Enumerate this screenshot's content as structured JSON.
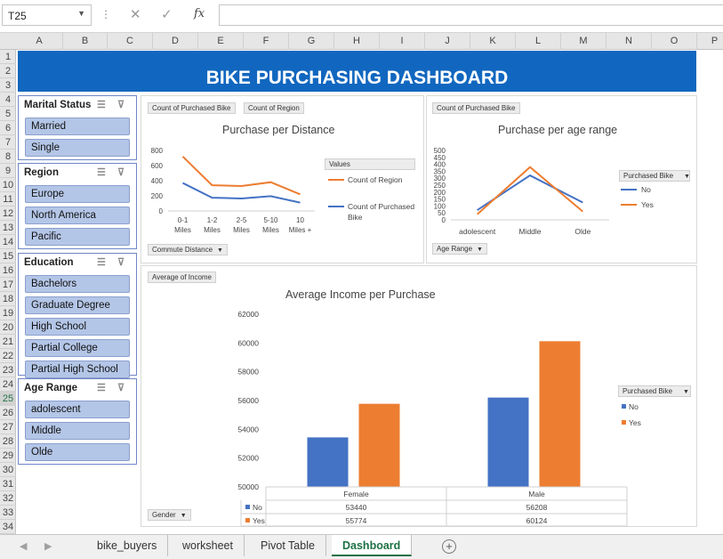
{
  "formula_bar": {
    "name_box": "T25",
    "formula": ""
  },
  "columns": [
    "A",
    "B",
    "C",
    "D",
    "E",
    "F",
    "G",
    "H",
    "I",
    "J",
    "K",
    "L",
    "M",
    "N",
    "O",
    "P"
  ],
  "rows": [
    "1",
    "2",
    "3",
    "4",
    "5",
    "6",
    "7",
    "8",
    "9",
    "10",
    "11",
    "12",
    "13",
    "14",
    "15",
    "16",
    "17",
    "18",
    "19",
    "20",
    "21",
    "22",
    "23",
    "24",
    "25",
    "26",
    "27",
    "28",
    "29",
    "30",
    "31",
    "32",
    "33",
    "34"
  ],
  "selected_row": "25",
  "dashboard_title": "BIKE PURCHASING DASHBOARD",
  "slicers": {
    "marital": {
      "title": "Marital Status",
      "items": [
        "Married",
        "Single"
      ]
    },
    "region": {
      "title": "Region",
      "items": [
        "Europe",
        "North America",
        "Pacific"
      ]
    },
    "education": {
      "title": "Education",
      "items": [
        "Bachelors",
        "Graduate Degree",
        "High School",
        "Partial College",
        "Partial High School"
      ]
    },
    "age": {
      "title": "Age Range",
      "items": [
        "adolescent",
        "Middle",
        "Olde"
      ]
    }
  },
  "chart_distance": {
    "btn_count_purchased": "Count of Purchased Bike",
    "btn_count_region": "Count of Region",
    "btn_commute": "Commute Distance",
    "legend_header": "Values",
    "colors": {
      "region": "#ed7d31",
      "purchased": "#4472c4"
    }
  },
  "chart_age": {
    "btn_count_purchased": "Count of Purchased Bike",
    "btn_age": "Age Range",
    "legend_header": "Purchased Bike",
    "colors": {
      "No": "#4472c4",
      "Yes": "#ed7d31"
    }
  },
  "chart_income": {
    "btn_avg_income": "Average of Income",
    "btn_gender": "Gender",
    "legend_header": "Purchased Bike",
    "colors": {
      "No": "#4472c4",
      "Yes": "#ed7d31"
    }
  },
  "sheet_tabs": [
    "bike_buyers",
    "worksheet",
    "Pivot Table",
    "Dashboard"
  ],
  "active_tab": "Dashboard",
  "chart_data": [
    {
      "type": "line",
      "title": "Purchase per Distance",
      "categories": [
        "0-1 Miles",
        "1-2 Miles",
        "2-5 Miles",
        "5-10 Miles",
        "10 Miles +"
      ],
      "series": [
        {
          "name": "Count of Region",
          "values": [
            720,
            340,
            330,
            380,
            220
          ]
        },
        {
          "name": "Count of Purchased Bike",
          "values": [
            370,
            175,
            165,
            195,
            110
          ]
        }
      ],
      "ylim": [
        0,
        800
      ],
      "yticks": [
        0,
        200,
        400,
        600,
        800
      ]
    },
    {
      "type": "line",
      "title": "Purchase per age range",
      "categories": [
        "adolescent",
        "Middle",
        "Olde"
      ],
      "series": [
        {
          "name": "No",
          "values": [
            70,
            320,
            125
          ]
        },
        {
          "name": "Yes",
          "values": [
            40,
            380,
            60
          ]
        }
      ],
      "ylim": [
        0,
        500
      ],
      "yticks": [
        0,
        50,
        100,
        150,
        200,
        250,
        300,
        350,
        400,
        450,
        500
      ]
    },
    {
      "type": "bar",
      "title": "Average Income per Purchase",
      "categories": [
        "Female",
        "Male"
      ],
      "series": [
        {
          "name": "No",
          "values": [
            53440,
            56208
          ]
        },
        {
          "name": "Yes",
          "values": [
            55774,
            60124
          ]
        }
      ],
      "ylim": [
        50000,
        62000
      ],
      "yticks": [
        50000,
        52000,
        54000,
        56000,
        58000,
        60000,
        62000
      ]
    }
  ]
}
